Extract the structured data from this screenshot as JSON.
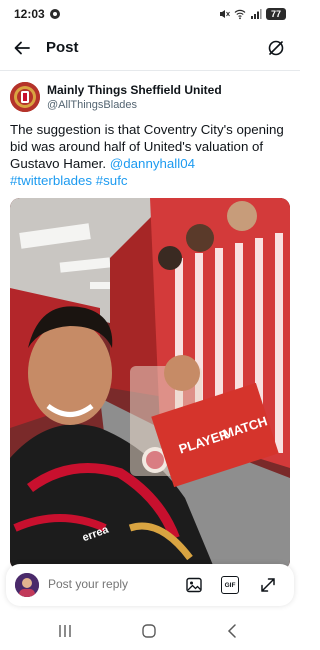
{
  "status_bar": {
    "time": "12:03",
    "battery": "77"
  },
  "header": {
    "title": "Post"
  },
  "tweet": {
    "author_name": "Mainly Things Sheffield United",
    "author_handle": "@AllThingsBlades",
    "text": "The suggestion is that Coventry  City's opening bid was around half of United's valuation of Gustavo Hamer. ",
    "mention": "@dannyhall04",
    "hashtag1": "#twitterblades",
    "hashtag2": "#sufc"
  },
  "media": {
    "trophy_line1": "PLAYER",
    "trophy_line2": "MATCH",
    "shirt_text": "errea"
  },
  "reply": {
    "placeholder": "Post your reply",
    "gif_label": "GIF"
  },
  "colors": {
    "link": "#1d9bf0",
    "brand_red": "#c8102e"
  }
}
